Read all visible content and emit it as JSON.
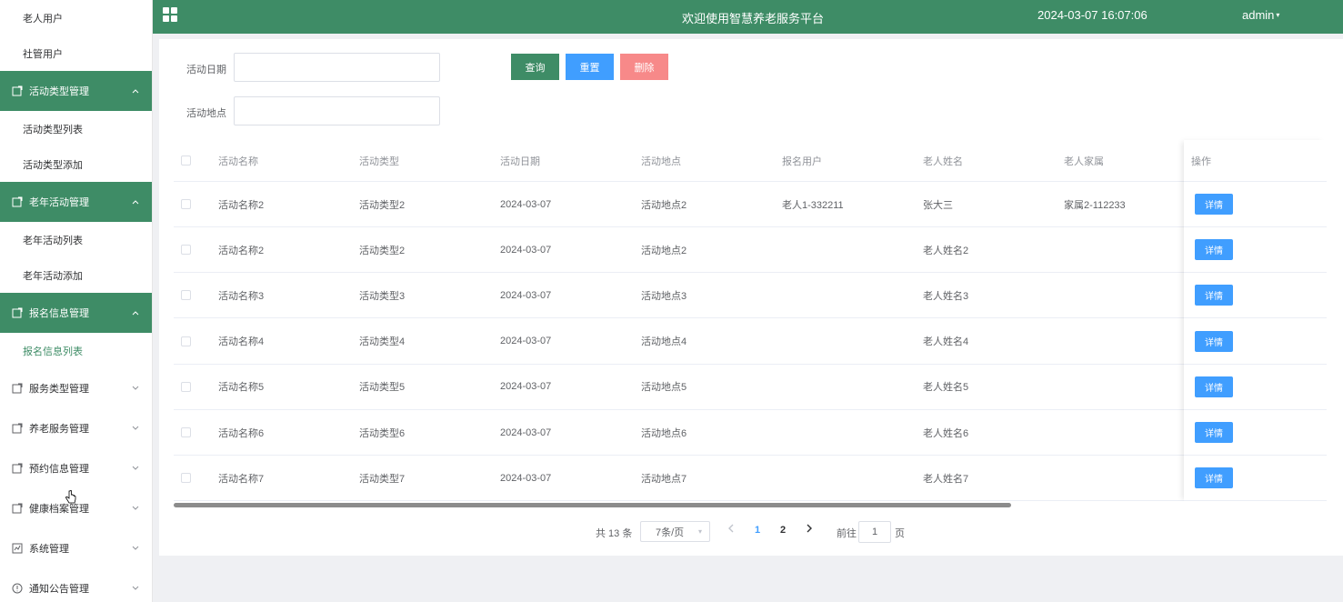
{
  "header": {
    "title": "欢迎使用智慧养老服务平台",
    "time": "2024-03-07 16:07:06",
    "user": "admin"
  },
  "sidebar": {
    "top_items": [
      "老人用户",
      "社管用户"
    ],
    "groups": [
      {
        "label": "活动类型管理",
        "open": true,
        "items": [
          "活动类型列表",
          "活动类型添加"
        ]
      },
      {
        "label": "老年活动管理",
        "open": true,
        "items": [
          "老年活动列表",
          "老年活动添加"
        ]
      },
      {
        "label": "报名信息管理",
        "open": true,
        "items": [
          "报名信息列表"
        ]
      },
      {
        "label": "服务类型管理",
        "open": false,
        "items": []
      },
      {
        "label": "养老服务管理",
        "open": false,
        "items": []
      },
      {
        "label": "预约信息管理",
        "open": false,
        "items": []
      },
      {
        "label": "健康档案管理",
        "open": false,
        "items": []
      },
      {
        "label": "系统管理",
        "open": false,
        "items": []
      },
      {
        "label": "通知公告管理",
        "open": false,
        "items": []
      }
    ],
    "active_item": "报名信息列表"
  },
  "search": {
    "date_label": "活动日期",
    "date_value": "",
    "place_label": "活动地点",
    "place_value": "",
    "query_label": "查询",
    "reset_label": "重置",
    "delete_label": "删除"
  },
  "table": {
    "columns": [
      "活动名称",
      "活动类型",
      "活动日期",
      "活动地点",
      "报名用户",
      "老人姓名",
      "老人家属",
      "操作"
    ],
    "rows": [
      [
        "活动名称2",
        "活动类型2",
        "2024-03-07",
        "活动地点2",
        "老人1-332211",
        "张大三",
        "家属2-112233"
      ],
      [
        "活动名称2",
        "活动类型2",
        "2024-03-07",
        "活动地点2",
        "",
        "老人姓名2",
        ""
      ],
      [
        "活动名称3",
        "活动类型3",
        "2024-03-07",
        "活动地点3",
        "",
        "老人姓名3",
        ""
      ],
      [
        "活动名称4",
        "活动类型4",
        "2024-03-07",
        "活动地点4",
        "",
        "老人姓名4",
        ""
      ],
      [
        "活动名称5",
        "活动类型5",
        "2024-03-07",
        "活动地点5",
        "",
        "老人姓名5",
        ""
      ],
      [
        "活动名称6",
        "活动类型6",
        "2024-03-07",
        "活动地点6",
        "",
        "老人姓名6",
        ""
      ],
      [
        "活动名称7",
        "活动类型7",
        "2024-03-07",
        "活动地点7",
        "",
        "老人姓名7",
        ""
      ]
    ],
    "detail_label": "详情"
  },
  "pagination": {
    "total": "共 13 条",
    "page_size": "7条/页",
    "pages": [
      "1",
      "2"
    ],
    "current": "1",
    "goto_label": "前往",
    "goto_value": "1",
    "page_suffix": "页"
  },
  "colors": {
    "primary_green": "#3e8c66",
    "blue": "#409eff",
    "red": "#f78989"
  }
}
